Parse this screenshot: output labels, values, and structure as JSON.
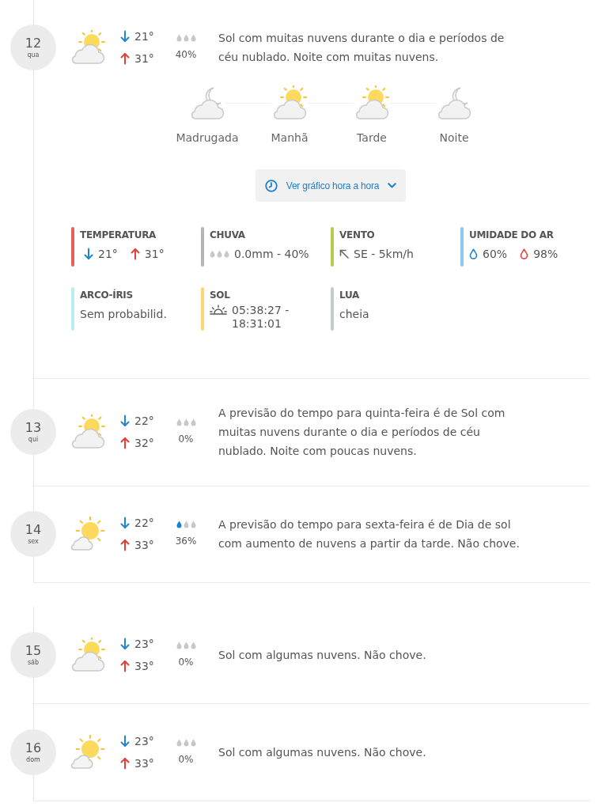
{
  "groups": [
    {
      "days": [
        {
          "day": "12",
          "weekday": "qua",
          "kind": "large-cloud",
          "min": "21°",
          "max": "31°",
          "rain_drops": [
            {
              "filled": false
            },
            {
              "filled": false
            },
            {
              "filled": false
            }
          ],
          "rain_chance": "40%",
          "description": "Sol com muitas nuvens durante o dia e períodos de céu nublado. Noite com muitas nuvens.",
          "periods": [
            {
              "label": "Madrugada",
              "kind": "night"
            },
            {
              "label": "Manhã",
              "kind": "day"
            },
            {
              "label": "Tarde",
              "kind": "day"
            },
            {
              "label": "Noite",
              "kind": "night"
            }
          ],
          "chart_button": "Ver gráfico hora a hora",
          "details": [
            {
              "kind": "temperature",
              "title": "TEMPERATURA",
              "color": "#e0625b",
              "min": "21°",
              "max": "31°"
            },
            {
              "kind": "rain",
              "title": "CHUVA",
              "color": "#b4b4b4",
              "rain_drops": [
                {
                  "filled": false
                },
                {
                  "filled": false
                },
                {
                  "filled": false
                }
              ],
              "value": "0.0mm - 40%"
            },
            {
              "kind": "wind",
              "title": "VENTO",
              "color": "#b9cb4e",
              "value": "SE - 5km/h"
            },
            {
              "kind": "humidity",
              "title": "UMIDADE DO AR",
              "color": "#8fc8f4",
              "min": "60%",
              "max": "98%"
            },
            {
              "kind": "plain",
              "title": "ARCO-ÍRIS",
              "color": "#b8eef1",
              "value": "Sem probabilid."
            },
            {
              "kind": "sunrise",
              "title": "SOL",
              "color": "#f9d870",
              "value": "05:38:27 - 18:31:01"
            },
            {
              "kind": "plain",
              "title": "LUA",
              "color": "#c2cbcf",
              "value": "cheia"
            }
          ]
        },
        {
          "day": "13",
          "weekday": "qui",
          "kind": "large-cloud",
          "min": "22°",
          "max": "32°",
          "rain_drops": [
            {
              "filled": false
            },
            {
              "filled": false
            },
            {
              "filled": false
            }
          ],
          "rain_chance": "0%",
          "description": "A previsão do tempo para quinta-feira é de Sol com muitas nuvens durante o dia e períodos de céu nublado. Noite com poucas nuvens."
        },
        {
          "day": "14",
          "weekday": "sex",
          "kind": "small-cloud",
          "min": "22°",
          "max": "33°",
          "rain_drops": [
            {
              "filled": true
            },
            {
              "filled": false
            },
            {
              "filled": false
            }
          ],
          "rain_chance": "36%",
          "description": "A previsão do tempo para sexta-feira é de Dia de sol com aumento de nuvens a partir da tarde. Não chove."
        }
      ]
    },
    {
      "days": [
        {
          "day": "15",
          "weekday": "sáb",
          "kind": "large-cloud",
          "min": "23°",
          "max": "33°",
          "rain_drops": [
            {
              "filled": false
            },
            {
              "filled": false
            },
            {
              "filled": false
            }
          ],
          "rain_chance": "0%",
          "description": "Sol com algumas nuvens. Não chove."
        },
        {
          "day": "16",
          "weekday": "dom",
          "kind": "small-cloud",
          "min": "23°",
          "max": "33°",
          "rain_drops": [
            {
              "filled": false
            },
            {
              "filled": false
            },
            {
              "filled": false
            }
          ],
          "rain_chance": "0%",
          "description": "Sol com algumas nuvens. Não chove."
        }
      ]
    }
  ]
}
